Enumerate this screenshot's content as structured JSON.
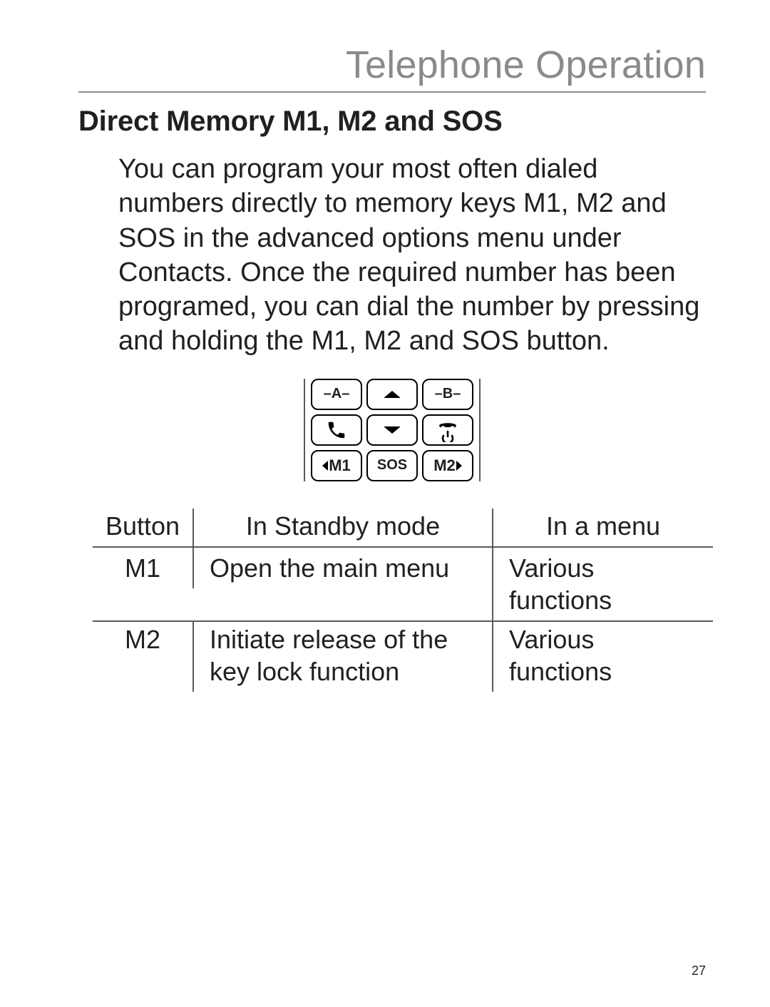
{
  "chapter_title": "Telephone Operation",
  "section_heading": "Direct Memory M1, M2 and SOS",
  "body_text": "You can program your most often dialed numbers directly to memory keys M1, M2 and SOS in the advanced options menu under Contacts. Once the required number has been programed, you can dial the number by pressing and holding the M1, M2 and SOS button.",
  "keypad": {
    "keys": {
      "a": "A",
      "b": "B",
      "m1": "M1",
      "sos": "SOS",
      "m2": "M2"
    }
  },
  "table": {
    "headers": {
      "button": "Button",
      "standby": "In Standby mode",
      "menu": "In a menu"
    },
    "rows": [
      {
        "button": "M1",
        "standby": "Open the main menu",
        "menu": "Various functions"
      },
      {
        "button": "M2",
        "standby": "Initiate release of the key lock function",
        "menu": "Various functions"
      }
    ]
  },
  "page_number": "27"
}
